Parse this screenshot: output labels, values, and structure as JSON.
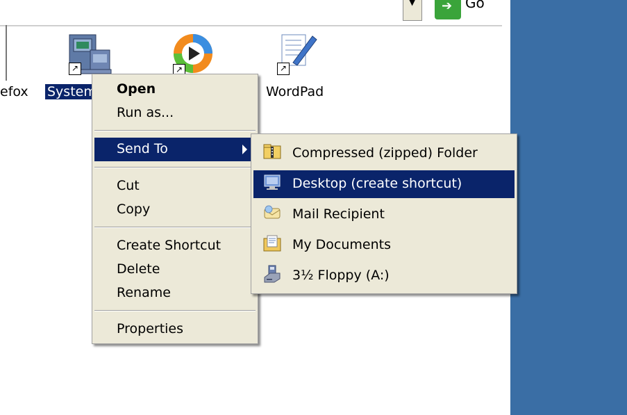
{
  "toolbar": {
    "go_label": "Go",
    "go_arrow": "➔"
  },
  "desktop": {
    "icons": [
      {
        "name": "Firefox",
        "label": "efox"
      },
      {
        "name": "System",
        "label": "System"
      },
      {
        "name": "Windows Media Player",
        "label": ""
      },
      {
        "name": "WordPad",
        "label": "WordPad"
      }
    ]
  },
  "context_menu": {
    "open": "Open",
    "run_as": "Run as...",
    "send_to": "Send To",
    "cut": "Cut",
    "copy": "Copy",
    "create_shortcut": "Create Shortcut",
    "delete": "Delete",
    "rename": "Rename",
    "properties": "Properties"
  },
  "send_to_menu": {
    "items": [
      {
        "label": "Compressed (zipped) Folder",
        "icon": "zip-folder-icon"
      },
      {
        "label": "Desktop (create shortcut)",
        "icon": "desktop-icon"
      },
      {
        "label": "Mail Recipient",
        "icon": "mail-icon"
      },
      {
        "label": "My Documents",
        "icon": "documents-folder-icon"
      },
      {
        "label": "3½ Floppy (A:)",
        "icon": "floppy-icon"
      }
    ]
  },
  "colors": {
    "highlight": "#0a246a",
    "menu_bg": "#ece9d8",
    "desktop_blue": "#3a6ea5"
  }
}
